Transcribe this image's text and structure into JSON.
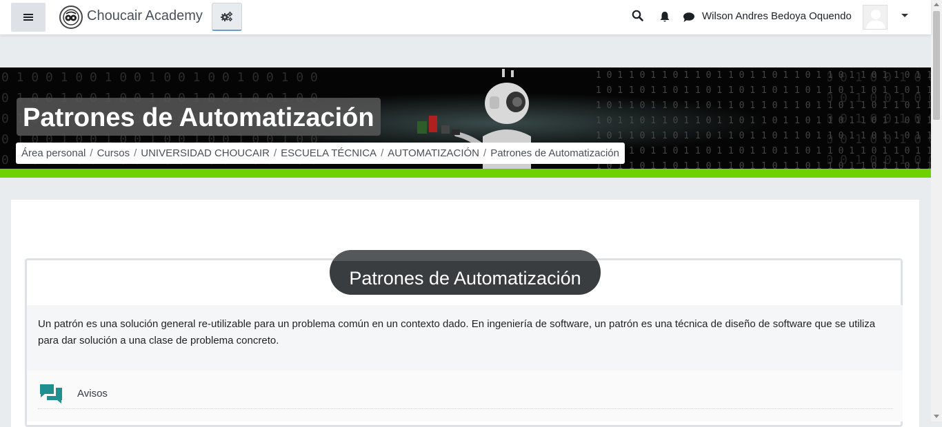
{
  "navbar": {
    "site_name": "Choucair Academy",
    "user_name": "Wilson Andres Bedoya Oquendo",
    "icons": {
      "menu": "hamburger-menu-icon",
      "settings": "gears-icon",
      "search": "search-icon",
      "notifications": "bell-icon",
      "messages": "chat-bubble-icon",
      "user_menu": "caret-down-icon"
    }
  },
  "header": {
    "course_title": "Patrones de Automatización",
    "breadcrumb": [
      "Área personal",
      "Cursos",
      "UNIVERSIDAD CHOUCAIR",
      "ESCUELA TÉCNICA",
      "AUTOMATIZACIÓN",
      "Patrones de Automatización"
    ],
    "breadcrumb_separator": "/"
  },
  "section": {
    "title": "Patrones de Automatización",
    "summary": "Un patrón es una solución general re-utilizable para un problema común en un contexto dado. En ingeniería de software, un patrón es una técnica de diseño de software que se utiliza para dar solución a una clase de problema concreto.",
    "activities": [
      {
        "name": "Avisos",
        "icon": "forum-icon"
      }
    ]
  },
  "colors": {
    "accent_green": "#6ed101",
    "forum_icon": "#1f8f8f",
    "page_background": "#e9ecef",
    "section_pill": "#3a3d40"
  }
}
